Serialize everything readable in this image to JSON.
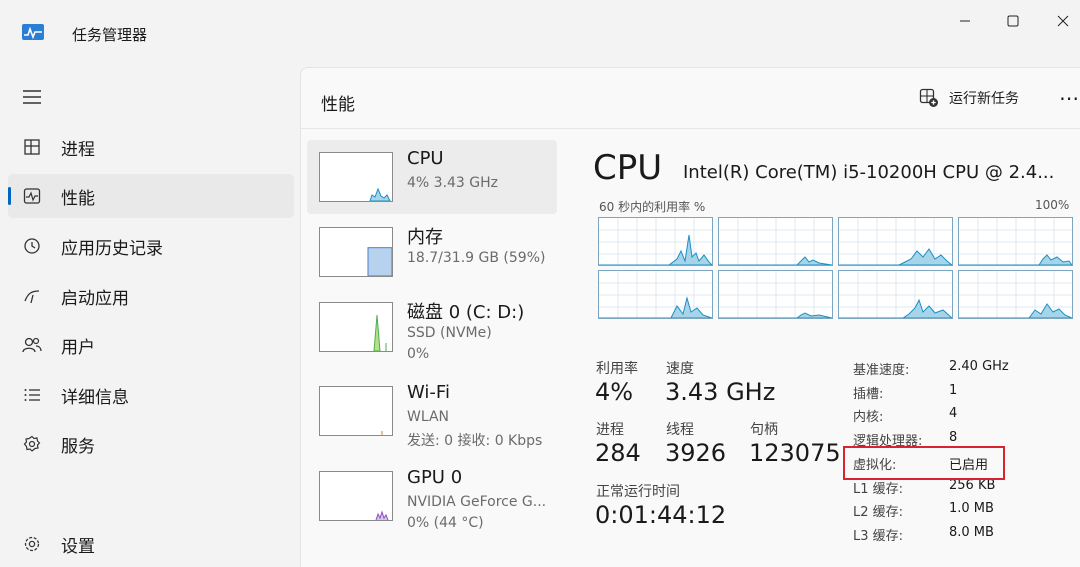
{
  "window": {
    "title": "任务管理器"
  },
  "sidebar": {
    "items": [
      {
        "label": "进程",
        "icon": "processes-icon"
      },
      {
        "label": "性能",
        "icon": "performance-icon"
      },
      {
        "label": "应用历史记录",
        "icon": "history-icon"
      },
      {
        "label": "启动应用",
        "icon": "startup-icon"
      },
      {
        "label": "用户",
        "icon": "users-icon"
      },
      {
        "label": "详细信息",
        "icon": "details-icon"
      },
      {
        "label": "服务",
        "icon": "services-icon"
      }
    ],
    "settings_label": "设置",
    "active_index": 1
  },
  "header": {
    "title": "性能",
    "run_new_task": "运行新任务",
    "more": "⋯"
  },
  "resources": [
    {
      "name": "CPU",
      "sub1": "4% 3.43 GHz",
      "sub2": ""
    },
    {
      "name": "内存",
      "sub1": "18.7/31.9 GB (59%)",
      "sub2": ""
    },
    {
      "name": "磁盘 0 (C: D:)",
      "sub1": "SSD (NVMe)",
      "sub2": "0%"
    },
    {
      "name": "Wi-Fi",
      "sub1": "WLAN",
      "sub2": "发送: 0 接收: 0 Kbps"
    },
    {
      "name": "GPU 0",
      "sub1": "NVIDIA GeForce G...",
      "sub2": "0% (44 °C)"
    }
  ],
  "memory_usage_percent": 59,
  "cpu_detail": {
    "title": "CPU",
    "model": "Intel(R) Core(TM) i5-10200H CPU @ 2.4...",
    "graph_label": "60 秒内的利用率 %",
    "graph_max": "100%",
    "stats": {
      "utilization_label": "利用率",
      "utilization": "4%",
      "speed_label": "速度",
      "speed": "3.43 GHz",
      "processes_label": "进程",
      "processes": "284",
      "threads_label": "线程",
      "threads": "3926",
      "handles_label": "句柄",
      "handles": "123075",
      "uptime_label": "正常运行时间",
      "uptime": "0:01:44:12"
    },
    "specs": [
      {
        "label": "基准速度:",
        "value": "2.40 GHz"
      },
      {
        "label": "插槽:",
        "value": "1"
      },
      {
        "label": "内核:",
        "value": "4"
      },
      {
        "label": "逻辑处理器:",
        "value": "8"
      },
      {
        "label": "虚拟化:",
        "value": "已启用"
      },
      {
        "label": "L1 缓存:",
        "value": "256 KB"
      },
      {
        "label": "L2 缓存:",
        "value": "1.0 MB"
      },
      {
        "label": "L3 缓存:",
        "value": "8.0 MB"
      }
    ]
  },
  "colors": {
    "accent": "#0067c0",
    "cpu_line": "#1b8fc4",
    "highlight": "#d7242f",
    "disk_line": "#4caf50",
    "gpu_line": "#8a4fbf"
  }
}
